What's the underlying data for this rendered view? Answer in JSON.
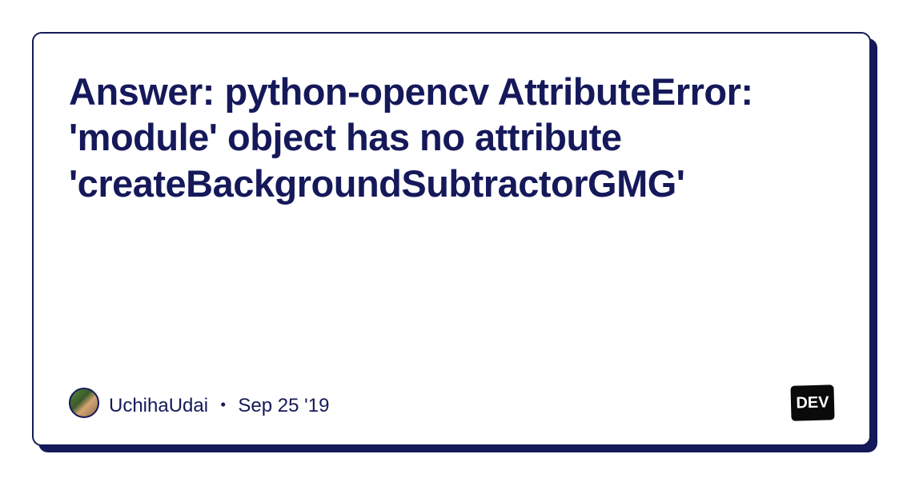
{
  "card": {
    "title": "Answer: python-opencv AttributeError: 'module' object has no attribute 'createBackgroundSubtractorGMG'"
  },
  "author": {
    "name": "UchihaUdai",
    "separator": " ・ ",
    "date": "Sep 25 '19"
  },
  "badge": {
    "label": "DEV"
  }
}
